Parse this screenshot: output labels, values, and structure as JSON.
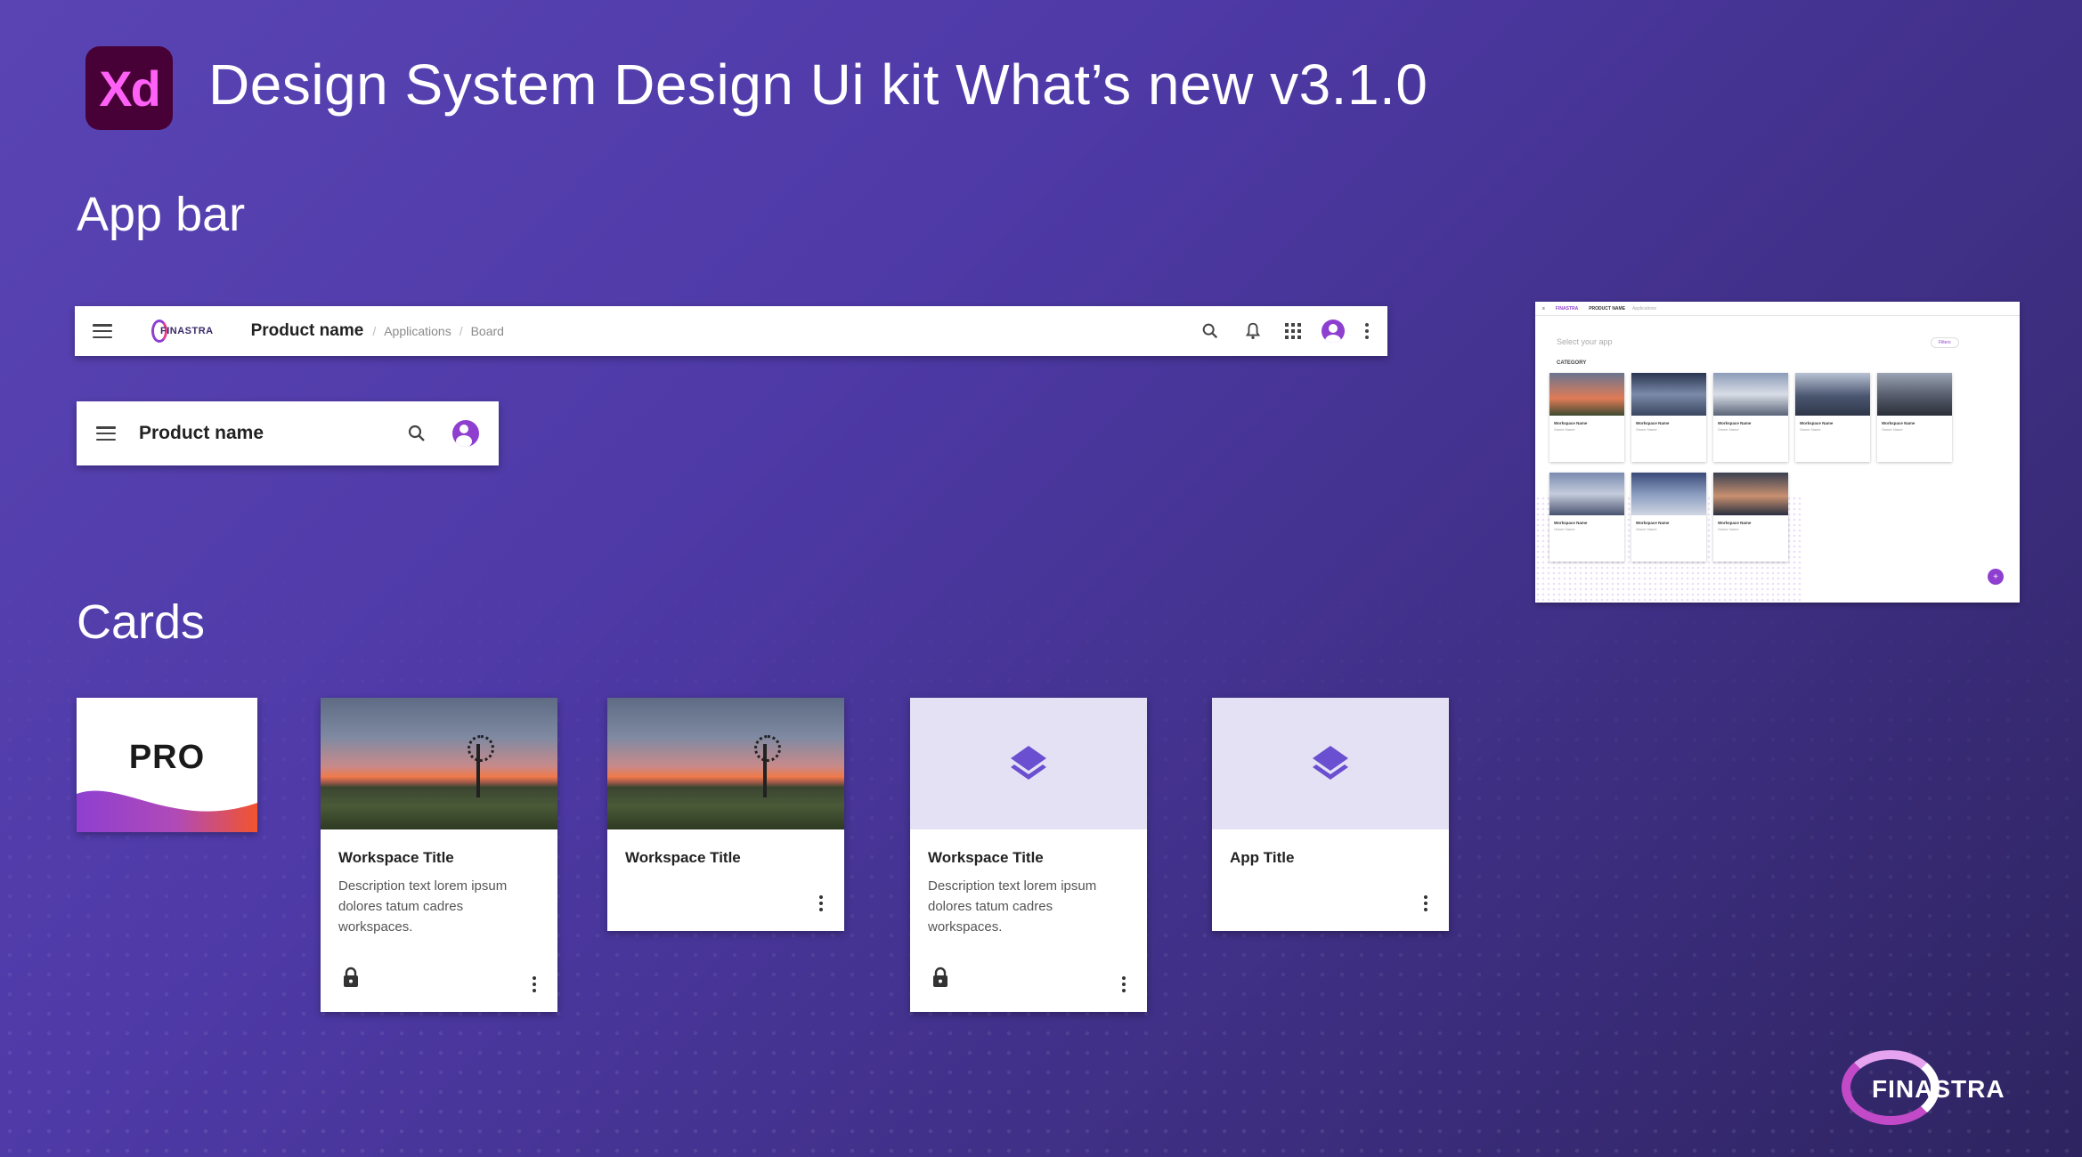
{
  "header": {
    "logo_text": "Xd",
    "title": "Design System Design Ui kit What’s new v3.1.0"
  },
  "sections": {
    "app_bar": "App bar",
    "cards": "Cards"
  },
  "app_bar_large": {
    "brand": "FINASTRA",
    "product_name": "Product name",
    "breadcrumbs": [
      "Applications",
      "Board"
    ],
    "separator": "/"
  },
  "app_bar_small": {
    "product_name": "Product name"
  },
  "preview": {
    "brand": "FINASTRA",
    "product_name": "PRODUCT NAME",
    "breadcrumb": "Applications",
    "select_label": "Select your app",
    "filters_label": "Filters",
    "category_label": "CATEGORY",
    "card_title": "Workspace Name",
    "card_subtitle": "Owner Name",
    "fab_label": "+"
  },
  "cards": {
    "pro_label": "PRO",
    "card1": {
      "title": "Workspace Title",
      "description": "Description text lorem ipsum dolores tatum cadres workspaces."
    },
    "card2": {
      "title": "Workspace Title"
    },
    "card3": {
      "title": "Workspace Title",
      "description": "Description text lorem ipsum dolores tatum cadres workspaces."
    },
    "card4": {
      "title": "App Title"
    }
  },
  "footer": {
    "brand": "FINASTRA"
  },
  "colors": {
    "background": "#4f3aa8",
    "accent": "#8e3fd0",
    "xd_logo_bg": "#470137",
    "xd_logo_fg": "#ff61f6",
    "card_media_lavender": "#e5e1f5",
    "layers_icon": "#6a4fd0"
  },
  "icons": [
    "menu-icon",
    "search-icon",
    "bell-icon",
    "apps-grid-icon",
    "account-icon",
    "more-vert-icon",
    "lock-icon",
    "layers-icon"
  ]
}
